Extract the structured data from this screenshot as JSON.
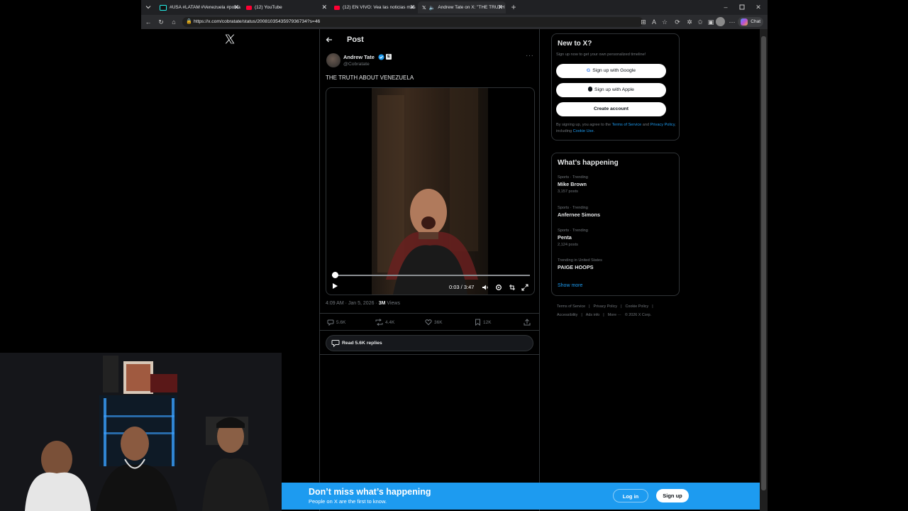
{
  "browser": {
    "tabs": [
      {
        "title": "#USA #LATAM #Venezuela #pobla",
        "icon": "tiktok-icon"
      },
      {
        "title": "(12) YouTube",
        "icon": "youtube-icon"
      },
      {
        "title": "(12) EN VIVO: Vea las noticias más",
        "icon": "youtube-icon"
      },
      {
        "title": "Andrew Tate on X: \"THE TRUTH",
        "icon": "x-icon"
      }
    ],
    "url": "https://x.com/cobratate/status/2008103543597936734?s=46",
    "chat_label": "Chat"
  },
  "post": {
    "header_title": "Post",
    "author_name": "Andrew Tate",
    "author_handle": "@Cobratate",
    "affiliate_badge": "E",
    "text": "THE TRUTH ABOUT VENEZUELA",
    "video": {
      "time": "0:03 / 3:47",
      "progress_fraction": 0.014
    },
    "meta_time": "4:09 AM · Jan 5, 2026 · ",
    "meta_views_count": "3M",
    "meta_views_label": " Views",
    "actions": {
      "replies": "5.6K",
      "reposts": "4.4K",
      "likes": "36K",
      "bookmarks": "12K"
    },
    "read_replies": "Read 5.6K replies"
  },
  "signup": {
    "title": "New to X?",
    "subtitle": "Sign up now to get your own personalized timeline!",
    "google_label": "Sign up with Google",
    "apple_label": "Sign up with Apple",
    "create_label": "Create account",
    "legal_prefix": "By signing up, you agree to the ",
    "terms_link": "Terms of Service",
    "legal_and": " and ",
    "privacy_link": "Privacy Policy",
    "legal_including": ", including ",
    "cookie_link": "Cookie Use",
    "legal_end": "."
  },
  "trending": {
    "title": "What’s happening",
    "items": [
      {
        "context": "Sports · Trending",
        "name": "Mike Brown",
        "count": "3,157 posts"
      },
      {
        "context": "Sports · Trending",
        "name": "Anfernee Simons",
        "count": ""
      },
      {
        "context": "Sports · Trending",
        "name": "Penta",
        "count": "2,124 posts"
      },
      {
        "context": "Trending in United States",
        "name": "PAIGE HOOPS",
        "count": ""
      }
    ],
    "show_more": "Show more"
  },
  "footer": {
    "links": [
      "Terms of Service",
      "|",
      "Privacy Policy",
      "|",
      "Cookie Policy",
      "|",
      "Accessibility",
      "|",
      "Ads info",
      "|",
      "More ···",
      "© 2026 X Corp."
    ]
  },
  "banner": {
    "title": "Don’t miss what’s happening",
    "subtitle": "People on X are the first to know.",
    "login_label": "Log in",
    "signup_label": "Sign up"
  },
  "colors": {
    "accent": "#1d9bf0",
    "background": "#000000",
    "border": "#2f3336",
    "muted_text": "#71767b"
  }
}
